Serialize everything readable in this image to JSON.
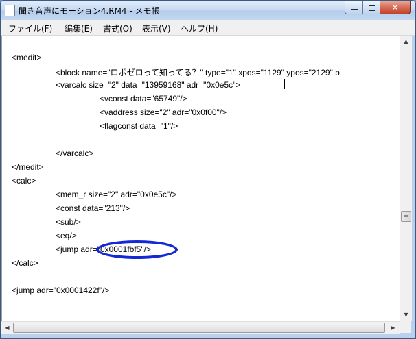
{
  "window": {
    "title": "聞き音声にモーション4.RM4 - メモ帳",
    "icon": "notepad-icon"
  },
  "menu": [
    {
      "label": "ファイル(F)"
    },
    {
      "label": "編集(E)"
    },
    {
      "label": "書式(O)"
    },
    {
      "label": "表示(V)"
    },
    {
      "label": "ヘルプ(H)"
    }
  ],
  "editor": {
    "lines": [
      "<medit>",
      "<block name=\"ロボゼロって知ってる？\" type=\"1\" xpos=\"1129\" ypos=\"2129\" b",
      "<varcalc size=\"2\" data=\"13959168\" adr=\"0x0e5c\">",
      "<vconst data=\"65749\"/>",
      "<vaddress size=\"2\" adr=\"0x0f00\"/>",
      "<flagconst data=\"1\"/>",
      "</varcalc>",
      "</medit>",
      "<calc>",
      "<mem_r size=\"2\" adr=\"0x0e5c\"/>",
      "<const data=\"213\"/>",
      "<sub/>",
      "<eq/>",
      "<jump adr=\"0x0001fbf5\"/>",
      "</calc>",
      "<jump adr=\"0x0001422f\"/>"
    ]
  },
  "colors": {
    "annotation_ellipse": "#1428d8",
    "close_button": "#c2432c"
  }
}
